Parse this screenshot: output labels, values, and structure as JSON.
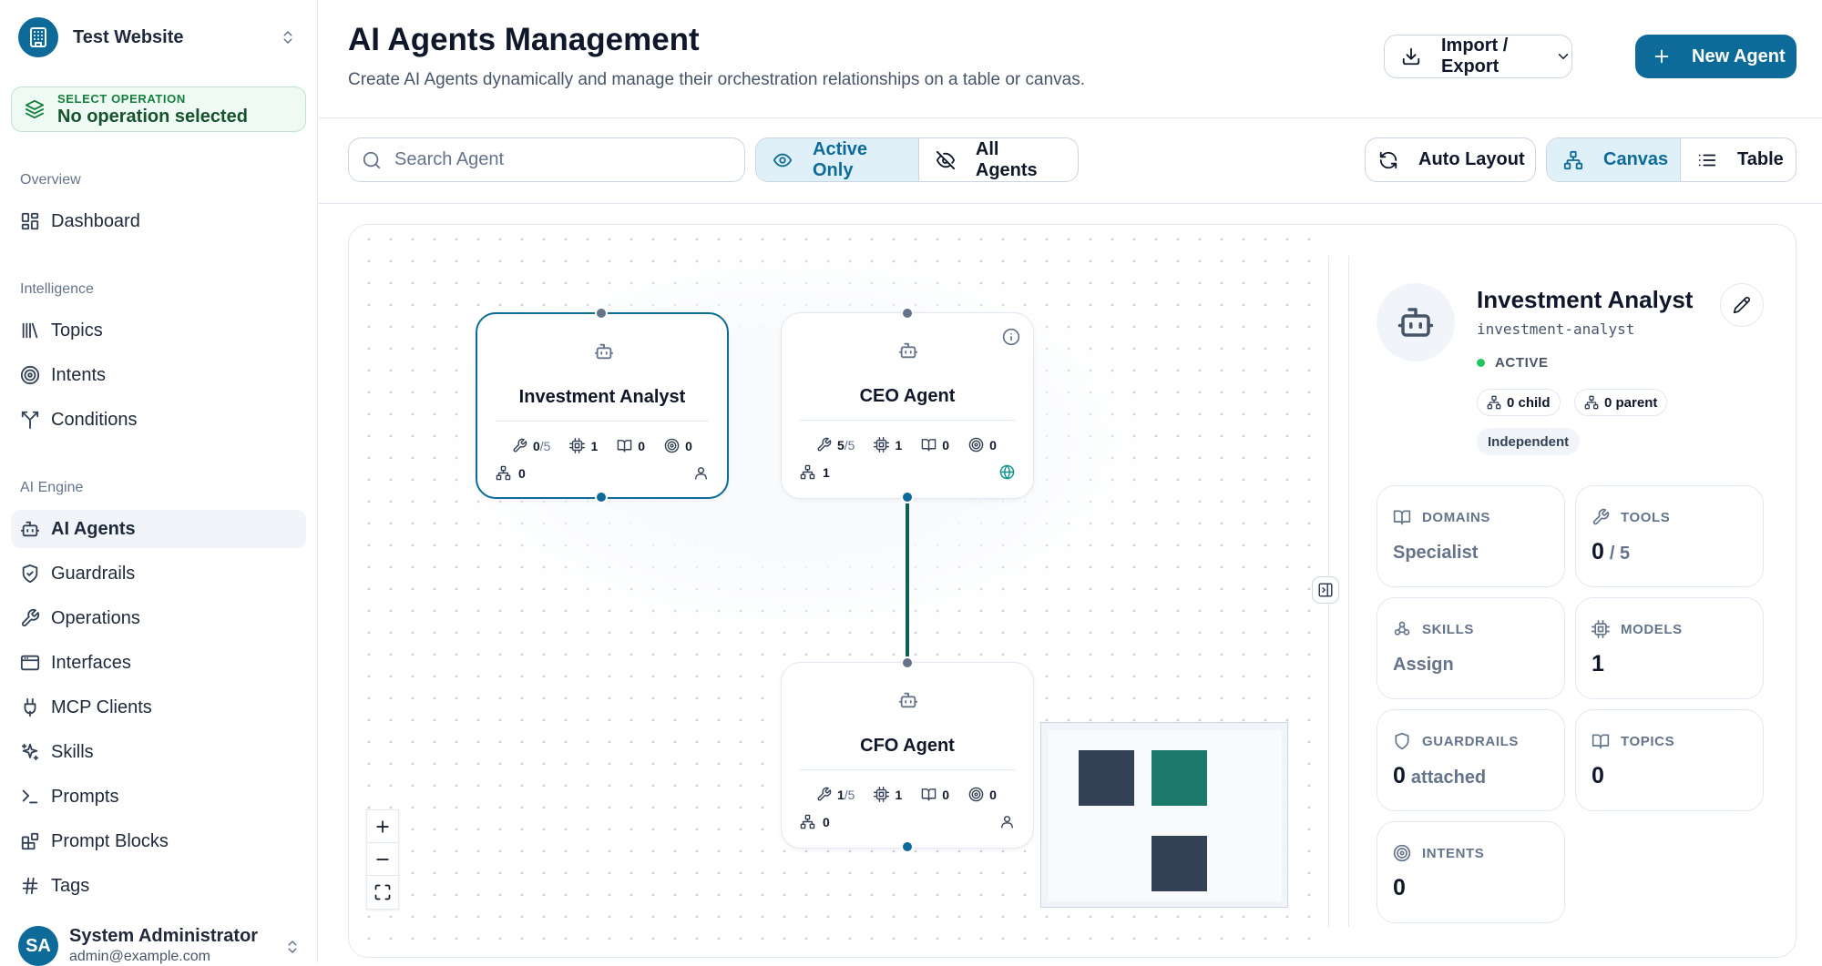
{
  "app": {
    "site_name": "Test Website",
    "operation_label": "SELECT OPERATION",
    "operation_value": "No operation selected"
  },
  "sidebar": {
    "sections": [
      {
        "title": "Overview",
        "items": [
          {
            "label": "Dashboard",
            "icon": "dashboard-icon"
          }
        ]
      },
      {
        "title": "Intelligence",
        "items": [
          {
            "label": "Topics",
            "icon": "library-icon"
          },
          {
            "label": "Intents",
            "icon": "target-icon"
          },
          {
            "label": "Conditions",
            "icon": "split-icon"
          }
        ]
      },
      {
        "title": "AI Engine",
        "items": [
          {
            "label": "AI Agents",
            "icon": "bot-icon",
            "active": true
          },
          {
            "label": "Guardrails",
            "icon": "shield-check-icon"
          },
          {
            "label": "Operations",
            "icon": "wrench-icon"
          },
          {
            "label": "Interfaces",
            "icon": "window-icon"
          },
          {
            "label": "MCP Clients",
            "icon": "plug-icon"
          },
          {
            "label": "Skills",
            "icon": "sparkles-icon"
          },
          {
            "label": "Prompts",
            "icon": "terminal-icon"
          },
          {
            "label": "Prompt Blocks",
            "icon": "blocks-icon"
          },
          {
            "label": "Tags",
            "icon": "hash-icon"
          }
        ]
      }
    ],
    "user": {
      "initials": "SA",
      "name": "System Administrator",
      "email": "admin@example.com"
    }
  },
  "header": {
    "title": "AI Agents Management",
    "subtitle": "Create AI Agents dynamically and manage their orchestration relationships on a table or canvas.",
    "import_export_label": "Import / Export",
    "new_agent_label": "New Agent"
  },
  "toolbar": {
    "search_placeholder": "Search Agent",
    "search_value": "",
    "active_only_label": "Active Only",
    "all_agents_label": "All Agents",
    "auto_layout_label": "Auto Layout",
    "canvas_label": "Canvas",
    "table_label": "Table",
    "visibility_selected": "Active Only",
    "view_selected": "Canvas"
  },
  "canvas": {
    "nodes": [
      {
        "name": "Investment Analyst",
        "tools": "0",
        "tools_total": "/5",
        "models": "1",
        "domains": "0",
        "intents": "0",
        "children": "0",
        "selected": true,
        "badge_icon": "user-icon"
      },
      {
        "name": "CEO Agent",
        "tools": "5",
        "tools_total": "/5",
        "models": "1",
        "domains": "0",
        "intents": "0",
        "children": "1",
        "selected": false,
        "badge_icon": "globe-icon"
      },
      {
        "name": "CFO Agent",
        "tools": "1",
        "tools_total": "/5",
        "models": "1",
        "domains": "0",
        "intents": "0",
        "children": "0",
        "selected": false,
        "badge_icon": "user-icon"
      }
    ],
    "edges": [
      {
        "from": "CEO Agent",
        "to": "CFO Agent"
      }
    ],
    "edge_color": "#0f5e5a",
    "minimap_colors": [
      "#334155",
      "#1b7a6a",
      "#334155"
    ]
  },
  "detail": {
    "name": "Investment Analyst",
    "slug": "investment-analyst",
    "status": "ACTIVE",
    "child_pill": "0 child",
    "parent_pill": "0 parent",
    "relation": "Independent",
    "cards": {
      "domains": {
        "title": "DOMAINS",
        "value": "Specialist"
      },
      "tools": {
        "title": "TOOLS",
        "value": "0",
        "sub": "/ 5"
      },
      "skills": {
        "title": "SKILLS",
        "value": "Assign"
      },
      "models": {
        "title": "MODELS",
        "value": "1"
      },
      "guardrails": {
        "title": "GUARDRAILS",
        "value": "0",
        "sub": "attached"
      },
      "topics": {
        "title": "TOPICS",
        "value": "0"
      },
      "intents": {
        "title": "INTENTS",
        "value": "0"
      }
    }
  },
  "colors": {
    "brand": "#0e6b99",
    "active_green": "#22c55e"
  }
}
